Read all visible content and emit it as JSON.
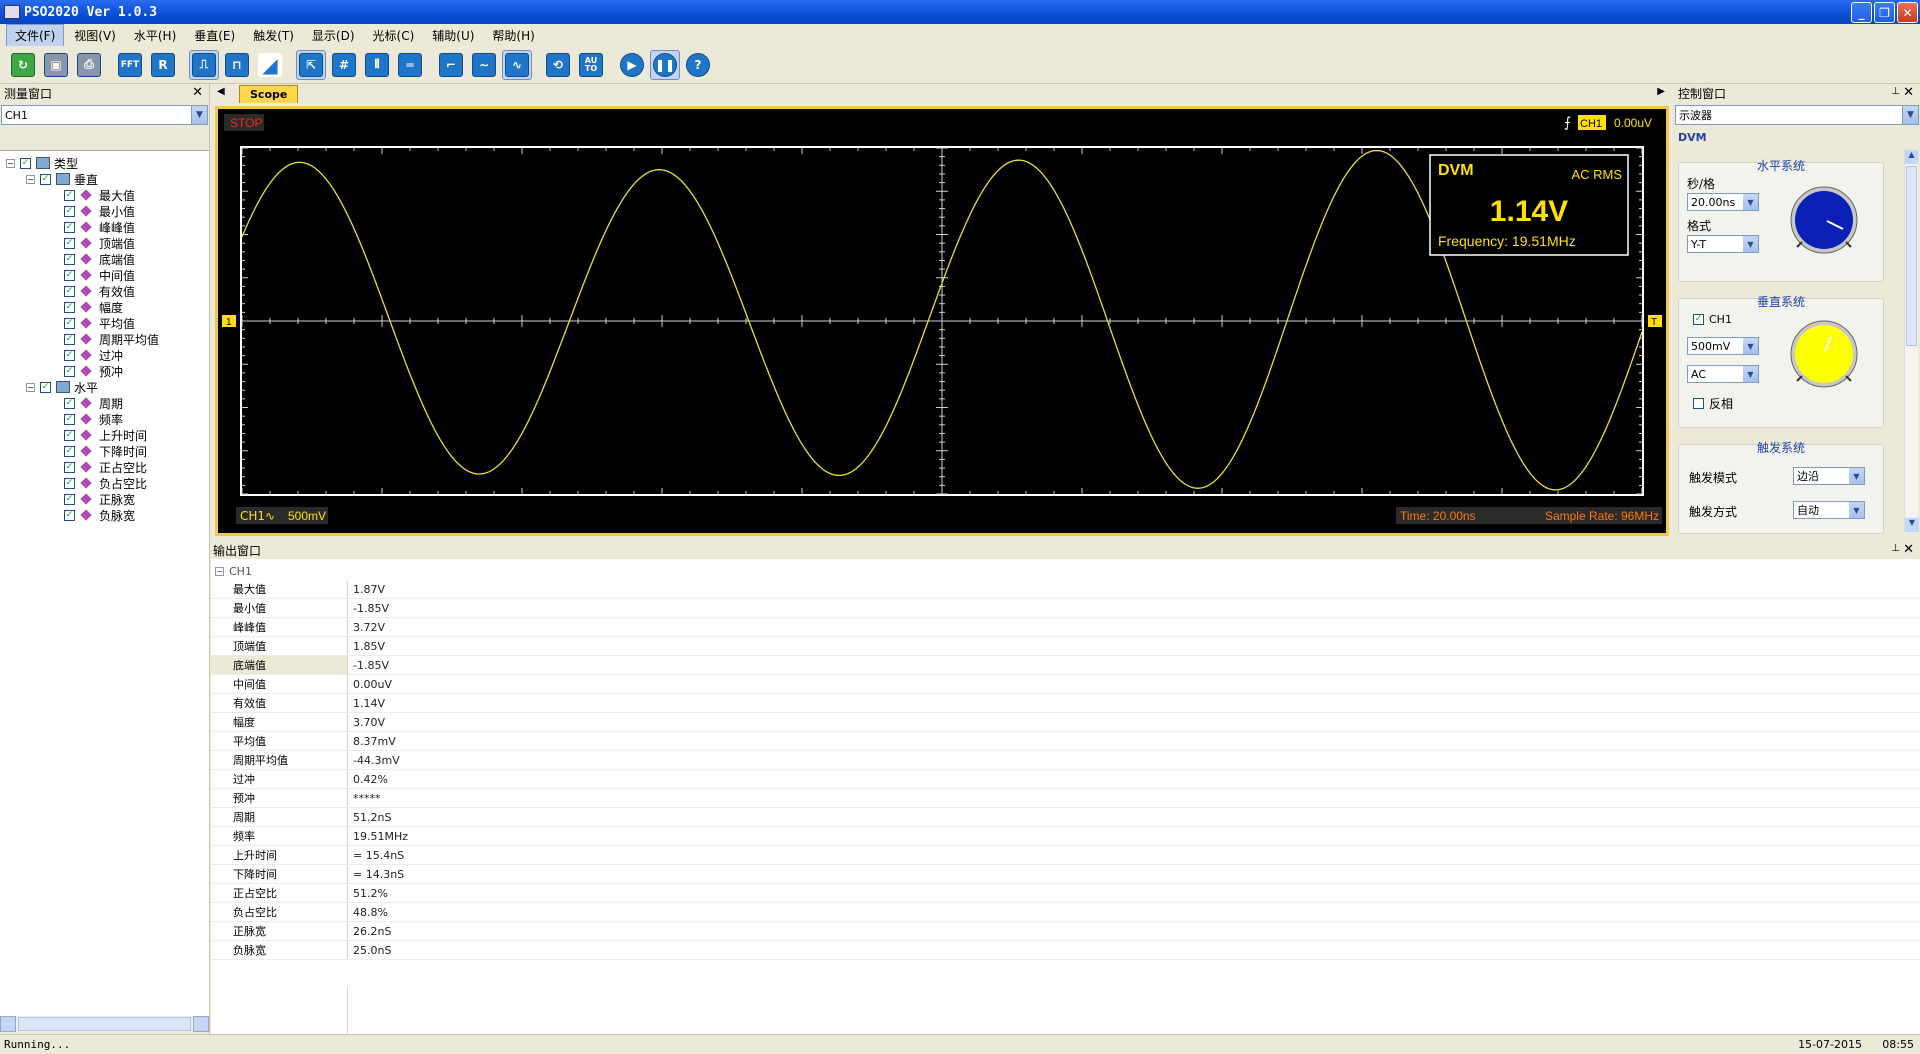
{
  "window": {
    "title": "PSO2020 Ver 1.0.3"
  },
  "menu": [
    "文件(F)",
    "视图(V)",
    "水平(H)",
    "垂直(E)",
    "触发(T)",
    "显示(D)",
    "光标(C)",
    "辅助(U)",
    "帮助(H)"
  ],
  "toolbar": {
    "fft_label": "FFT",
    "r_label": "R",
    "auto_label": "AU TO",
    "help_label": "?"
  },
  "measure_panel": {
    "title": "测量窗口",
    "channel": "CH1",
    "root_label": "类型",
    "vertical_label": "垂直",
    "vertical_items": [
      "最大值",
      "最小值",
      "峰峰值",
      "顶端值",
      "底端值",
      "中间值",
      "有效值",
      "幅度",
      "平均值",
      "周期平均值",
      "过冲",
      "预冲"
    ],
    "horizontal_label": "水平",
    "horizontal_items": [
      "周期",
      "频率",
      "上升时间",
      "下降时间",
      "正占空比",
      "负占空比",
      "正脉宽",
      "负脉宽"
    ]
  },
  "scope": {
    "tab_label": "Scope",
    "status": "STOP",
    "trigger_channel": "CH1",
    "trigger_level": "0.00uV",
    "ch_marker": "1",
    "trig_marker": "T",
    "dvm_title": "DVM",
    "dvm_mode": "AC RMS",
    "dvm_value": "1.14V",
    "dvm_frequency": "Frequency: 19.51MHz",
    "ch_label": "CH1∿",
    "ch_scale": "500mV",
    "time_label": "Time: 20.00ns",
    "sample_rate": "Sample Rate: 96MHz",
    "colors": {
      "trace": "#e8e030",
      "grid": "#cfcfcf",
      "label": "#ff7a00",
      "dvm": "#ffe000"
    }
  },
  "control_panel": {
    "title": "控制窗口",
    "device": "示波器",
    "section": "DVM",
    "horizontal_title": "水平系统",
    "timebase_label": "秒/格",
    "timebase_value": "20.00ns",
    "format_label": "格式",
    "format_value": "Y-T",
    "vertical_title": "垂直系统",
    "ch1_label": "CH1",
    "volts_value": "500mV",
    "coupling_value": "AC",
    "invert_label": "反相",
    "trigger_title": "触发系统",
    "trigger_mode_label": "触发模式",
    "trigger_mode_value": "边沿",
    "trigger_type_label": "触发方式",
    "trigger_type_value": "自动"
  },
  "output_panel": {
    "title": "输出窗口",
    "group": "CH1",
    "rows": [
      {
        "k": "最大值",
        "v": "1.87V"
      },
      {
        "k": "最小值",
        "v": "-1.85V"
      },
      {
        "k": "峰峰值",
        "v": "3.72V"
      },
      {
        "k": "顶端值",
        "v": "1.85V"
      },
      {
        "k": "底端值",
        "v": "-1.85V"
      },
      {
        "k": "中间值",
        "v": "0.00uV"
      },
      {
        "k": "有效值",
        "v": "1.14V"
      },
      {
        "k": "幅度",
        "v": "3.70V"
      },
      {
        "k": "平均值",
        "v": "8.37mV"
      },
      {
        "k": "周期平均值",
        "v": "-44.3mV"
      },
      {
        "k": "过冲",
        "v": "0.42%"
      },
      {
        "k": "预冲",
        "v": "*****"
      },
      {
        "k": "周期",
        "v": "51.2nS"
      },
      {
        "k": "频率",
        "v": "19.51MHz"
      },
      {
        "k": "上升时间",
        "v": "= 15.4nS"
      },
      {
        "k": "下降时间",
        "v": "= 14.3nS"
      },
      {
        "k": "正占空比",
        "v": "51.2%"
      },
      {
        "k": "负占空比",
        "v": "48.8%"
      },
      {
        "k": "正脉宽",
        "v": "26.2nS"
      },
      {
        "k": "负脉宽",
        "v": "25.0nS"
      }
    ]
  },
  "statusbar": {
    "text": "Running...",
    "date": "15-07-2015",
    "time": "08:55"
  }
}
